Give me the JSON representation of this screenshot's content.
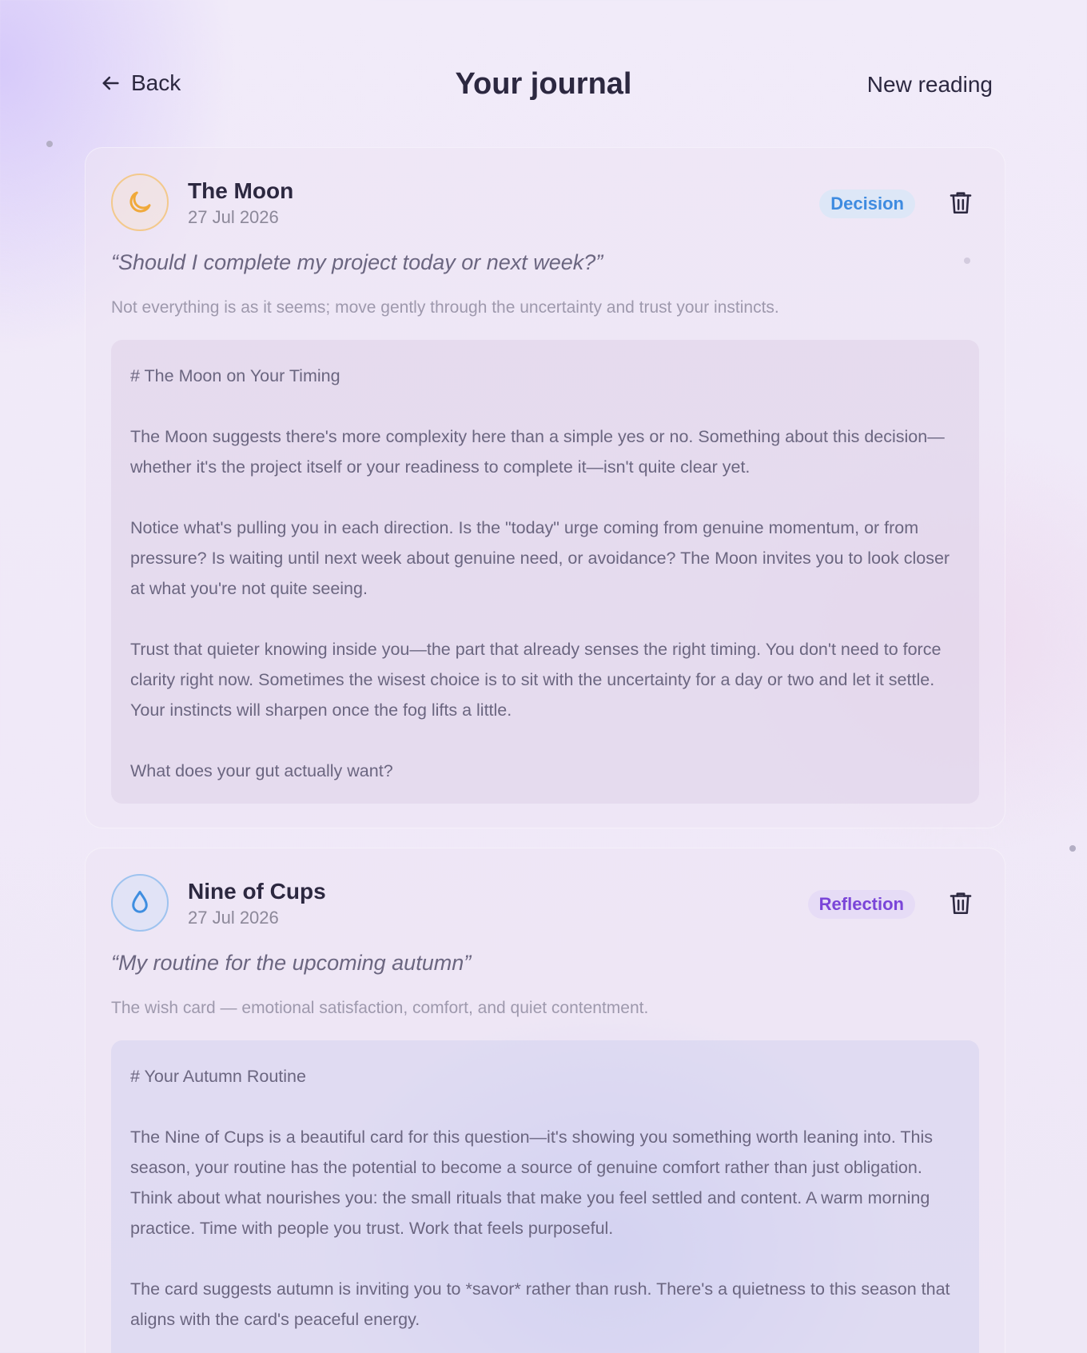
{
  "header": {
    "back_label": "Back",
    "title": "Your journal",
    "new_reading_label": "New reading"
  },
  "entries": [
    {
      "card_name": "The Moon",
      "date": "27 Jul 2026",
      "icon": "moon-icon",
      "badge": "Decision",
      "question": "“Should I complete my project today or next week?”",
      "summary": "Not everything is as it seems; move gently through the uncertainty and trust your instincts.",
      "reading": [
        "# The Moon on Your Timing",
        "The Moon suggests there's more complexity here than a simple yes or no. Something about this decision—whether it's the project itself or your readiness to complete it—isn't quite clear yet.",
        "Notice what's pulling you in each direction. Is the \"today\" urge coming from genuine momentum, or from pressure? Is waiting until next week about genuine need, or avoidance? The Moon invites you to look closer at what you're not quite seeing.",
        "Trust that quieter knowing inside you—the part that already senses the right timing. You don't need to force clarity right now. Sometimes the wisest choice is to sit with the uncertainty for a day or two and let it settle. Your instincts will sharpen once the fog lifts a little.",
        "What does your gut actually want?"
      ]
    },
    {
      "card_name": "Nine of Cups",
      "date": "27 Jul 2026",
      "icon": "water-drop-icon",
      "badge": "Reflection",
      "question": "“My routine for the upcoming autumn”",
      "summary": "The wish card — emotional satisfaction, comfort, and quiet contentment.",
      "reading": [
        "# Your Autumn Routine",
        "The Nine of Cups is a beautiful card for this question—it's showing you something worth leaning into. This season, your routine has the potential to become a source of genuine comfort rather than just obligation. Think about what nourishes you: the small rituals that make you feel settled and content. A warm morning practice. Time with people you trust. Work that feels purposeful.",
        "The card suggests autumn is inviting you to *savor* rather than rush. There's a quietness to this season that aligns with the card's peaceful energy."
      ]
    }
  ],
  "colors": {
    "moon_accent": "#f0a93a",
    "cups_accent": "#3f8ee0",
    "decision_badge": "#3e8be0",
    "reflection_badge": "#7a45d8"
  }
}
